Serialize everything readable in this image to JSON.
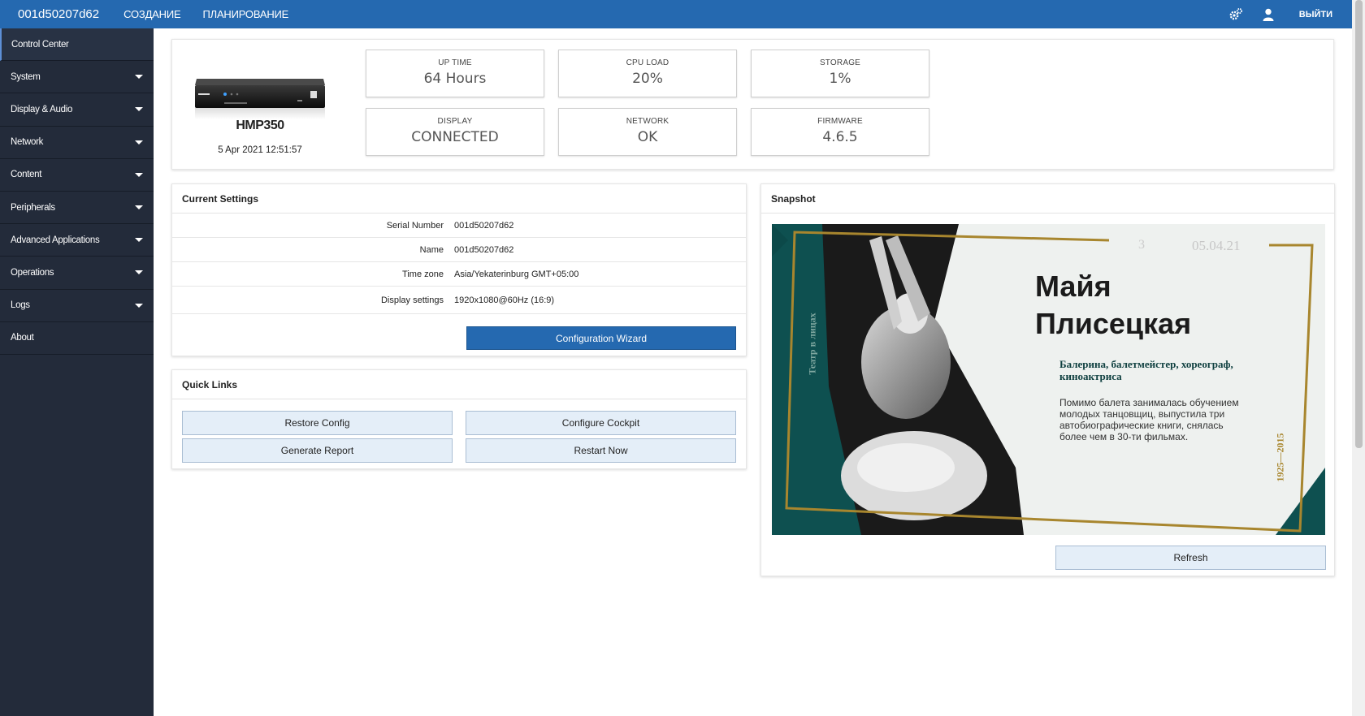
{
  "topbar": {
    "device_id": "001d50207d62",
    "nav": [
      "СОЗДАНИЕ",
      "ПЛАНИРОВАНИЕ"
    ],
    "logout": "ВЫЙТИ"
  },
  "sidebar": {
    "items": [
      {
        "label": "Control Center",
        "expandable": false
      },
      {
        "label": "System",
        "expandable": true
      },
      {
        "label": "Display & Audio",
        "expandable": true
      },
      {
        "label": "Network",
        "expandable": true
      },
      {
        "label": "Content",
        "expandable": true
      },
      {
        "label": "Peripherals",
        "expandable": true
      },
      {
        "label": "Advanced Applications",
        "expandable": true
      },
      {
        "label": "Operations",
        "expandable": true
      },
      {
        "label": "Logs",
        "expandable": true
      },
      {
        "label": "About",
        "expandable": false
      }
    ]
  },
  "device": {
    "model": "HMP350",
    "datetime": "5 Apr 2021 12:51:57"
  },
  "stats": [
    {
      "label": "UP TIME",
      "value": "64 Hours"
    },
    {
      "label": "CPU LOAD",
      "value": "20%"
    },
    {
      "label": "STORAGE",
      "value": "1%"
    },
    {
      "label": "DISPLAY",
      "value": "CONNECTED"
    },
    {
      "label": "NETWORK",
      "value": "OK"
    },
    {
      "label": "FIRMWARE",
      "value": "4.6.5"
    }
  ],
  "current_settings": {
    "title": "Current Settings",
    "rows": [
      {
        "key": "Serial Number",
        "value": "001d50207d62"
      },
      {
        "key": "Name",
        "value": "001d50207d62"
      },
      {
        "key": "Time zone",
        "value": "Asia/Yekaterinburg GMT+05:00"
      },
      {
        "key": "Display settings",
        "value": "1920x1080@60Hz (16:9)"
      }
    ],
    "wizard_button": "Configuration Wizard"
  },
  "quick_links": {
    "title": "Quick Links",
    "buttons": [
      "Restore Config",
      "Configure Cockpit",
      "Generate Report",
      "Restart Now"
    ]
  },
  "snapshot": {
    "title": "Snapshot",
    "refresh_button": "Refresh",
    "poster": {
      "number": "3",
      "date": "05.04.21",
      "name_line1": "Майя",
      "name_line2": "Плисецкая",
      "subtitle": "Балерина, балетмейстер, хореограф, киноактриса",
      "body": "Помимо балета занималась обучением молодых танцовщиц, выпустила три автобиографические книги, снялась более чем в 30-ти фильмах.",
      "vertical_left": "Театр в лицах",
      "vertical_right": "1925—2015"
    }
  },
  "colors": {
    "topbar": "#2569b0",
    "sidebar": "#232b3a",
    "primary_button": "#2569b0",
    "light_button": "#e4eef8",
    "poster_teal": "#0e5050",
    "poster_gold": "#a8862e"
  }
}
